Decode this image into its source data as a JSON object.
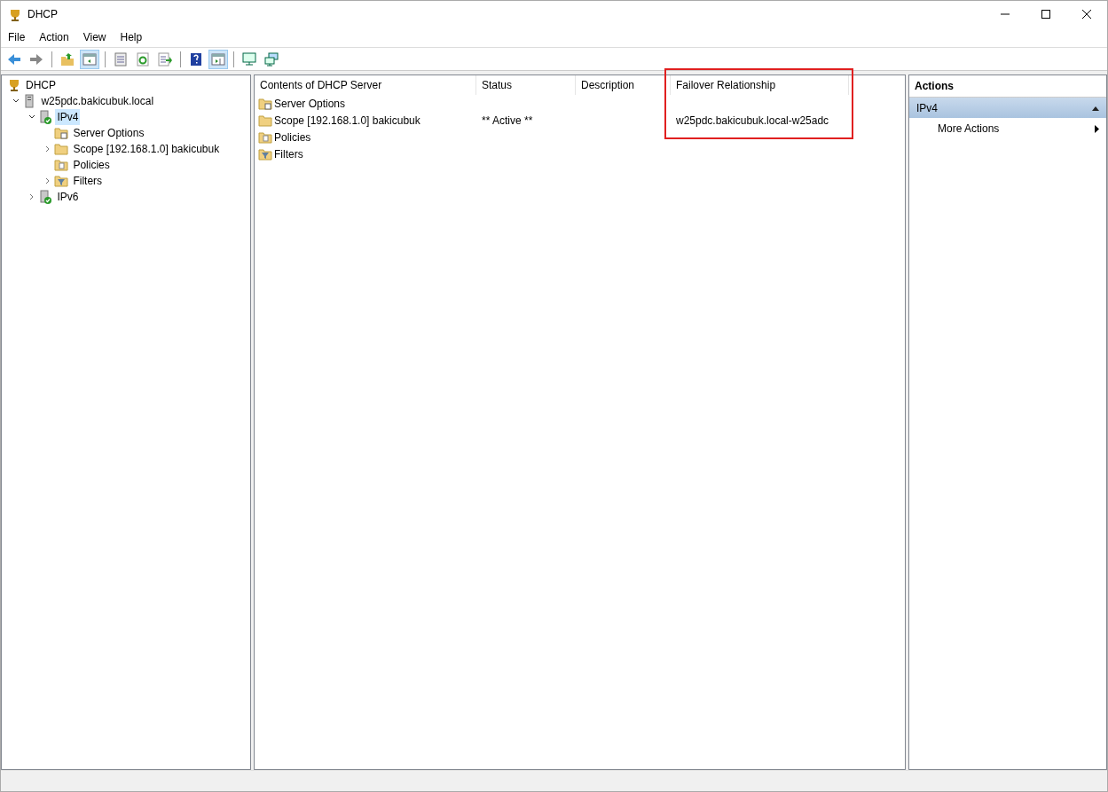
{
  "window": {
    "title": "DHCP"
  },
  "menu": [
    "File",
    "Action",
    "View",
    "Help"
  ],
  "toolbar": [
    {
      "kind": "back",
      "pressed": false
    },
    {
      "kind": "forward",
      "pressed": false
    },
    {
      "kind": "sep"
    },
    {
      "kind": "up",
      "pressed": false
    },
    {
      "kind": "tree",
      "pressed": true
    },
    {
      "kind": "sep"
    },
    {
      "kind": "properties",
      "pressed": false
    },
    {
      "kind": "refresh",
      "pressed": false
    },
    {
      "kind": "export",
      "pressed": false
    },
    {
      "kind": "sep"
    },
    {
      "kind": "help",
      "pressed": false
    },
    {
      "kind": "actionpane",
      "pressed": true
    },
    {
      "kind": "sep"
    },
    {
      "kind": "monitor",
      "pressed": false
    },
    {
      "kind": "network",
      "pressed": false
    }
  ],
  "tree": [
    {
      "label": "DHCP",
      "kind": "dhcp",
      "selected": false,
      "children": [
        {
          "label": "w25pdc.bakicubuk.local",
          "kind": "server",
          "selected": false,
          "expanded": true,
          "children": [
            {
              "label": "IPv4",
              "kind": "ip",
              "selected": true,
              "expanded": true,
              "children": [
                {
                  "label": "Server Options",
                  "kind": "options",
                  "selected": false
                },
                {
                  "label": "Scope [192.168.1.0] bakicubuk",
                  "kind": "folder",
                  "selected": false,
                  "expanded": false,
                  "has_children": true
                },
                {
                  "label": "Policies",
                  "kind": "policy",
                  "selected": false
                },
                {
                  "label": "Filters",
                  "kind": "filter",
                  "selected": false,
                  "expanded": false,
                  "has_children": true
                }
              ]
            },
            {
              "label": "IPv6",
              "kind": "ip",
              "selected": false,
              "expanded": false,
              "has_children": true
            }
          ]
        }
      ]
    }
  ],
  "list": {
    "columns": [
      {
        "label": "Contents of DHCP Server"
      },
      {
        "label": "Status"
      },
      {
        "label": "Description"
      },
      {
        "label": "Failover Relationship",
        "highlighted": true
      }
    ],
    "rows": [
      {
        "kind": "options",
        "cells": [
          "Server Options",
          "",
          "",
          ""
        ]
      },
      {
        "kind": "folder",
        "cells": [
          "Scope [192.168.1.0] bakicubuk",
          "** Active **",
          "",
          "w25pdc.bakicubuk.local-w25adc"
        ]
      },
      {
        "kind": "policy",
        "cells": [
          "Policies",
          "",
          "",
          ""
        ]
      },
      {
        "kind": "filter",
        "cells": [
          "Filters",
          "",
          "",
          ""
        ]
      }
    ]
  },
  "actions": {
    "title": "Actions",
    "sections": [
      {
        "title": "IPv4",
        "expanded": true,
        "items": [
          {
            "label": "More Actions",
            "submenu": true
          }
        ]
      }
    ]
  }
}
